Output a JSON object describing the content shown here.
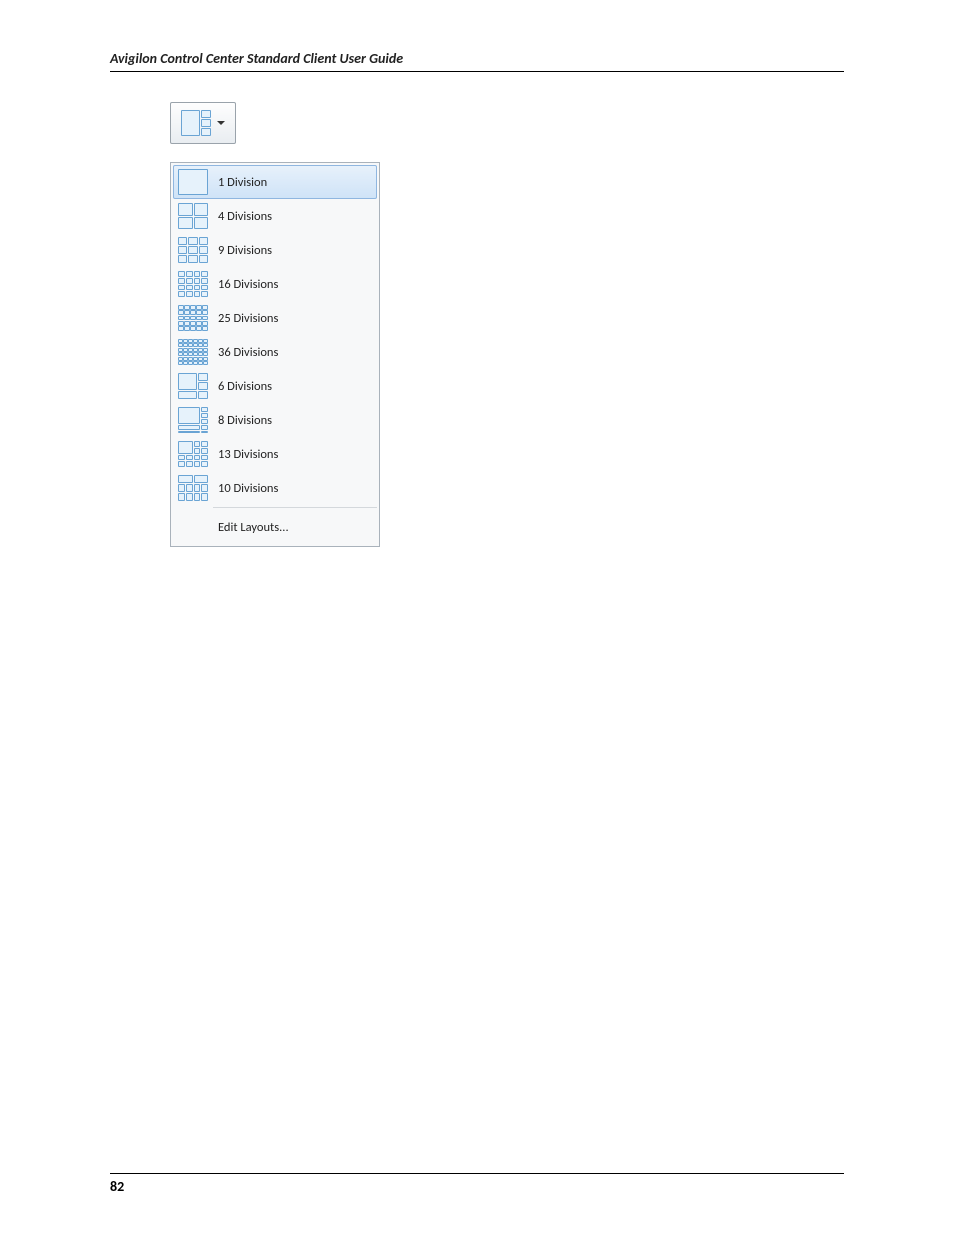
{
  "doc": {
    "header_title": "Avigilon Control Center Standard Client User Guide",
    "page_number": "82"
  },
  "dropdown": {
    "items": [
      {
        "label": "1 Division",
        "selected": true,
        "icon": "g1",
        "cells": 1
      },
      {
        "label": "4 Divisions",
        "selected": false,
        "icon": "g4",
        "cells": 4
      },
      {
        "label": "9 Divisions",
        "selected": false,
        "icon": "g9",
        "cells": 9
      },
      {
        "label": "16 Divisions",
        "selected": false,
        "icon": "g16",
        "cells": 16
      },
      {
        "label": "25 Divisions",
        "selected": false,
        "icon": "g25",
        "cells": 25
      },
      {
        "label": "36 Divisions",
        "selected": false,
        "icon": "g36",
        "cells": 36
      },
      {
        "label": "6 Divisions",
        "selected": false,
        "icon": "g6",
        "cells": 5
      },
      {
        "label": "8 Divisions",
        "selected": false,
        "icon": "g8",
        "cells": 8
      },
      {
        "label": "13 Divisions",
        "selected": false,
        "icon": "g13",
        "cells": 13
      },
      {
        "label": "10 Divisions",
        "selected": false,
        "icon": "g10",
        "cells": 10
      }
    ],
    "edit_label": "Edit Layouts..."
  }
}
